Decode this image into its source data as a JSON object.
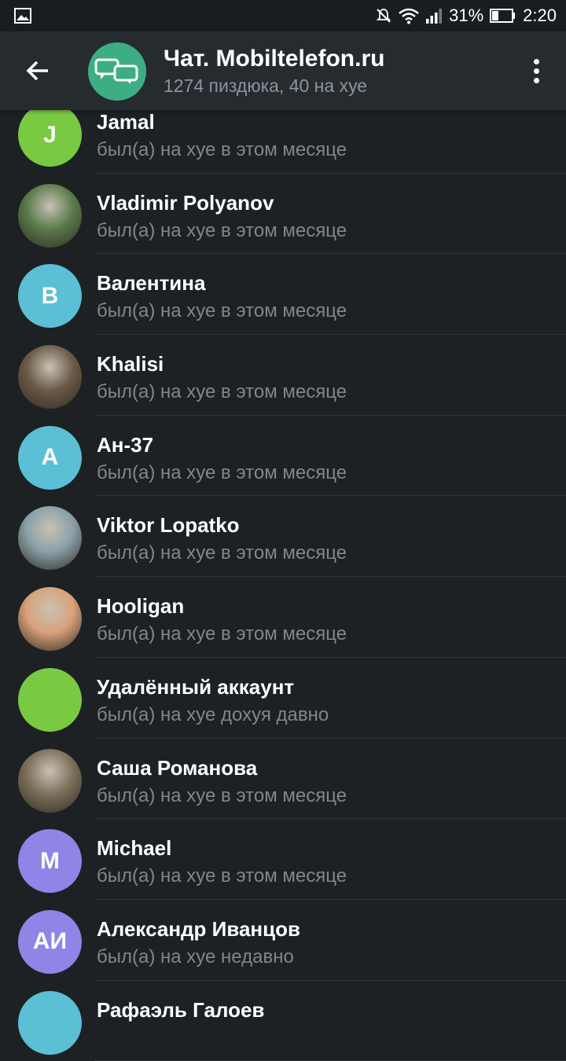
{
  "status_bar": {
    "battery_percent": "31%",
    "time": "2:20"
  },
  "header": {
    "title": "Чат. Mobiltelefon.ru",
    "subtitle": "1274 пиздюка, 40 на хуе",
    "avatar_color": "#3dae84"
  },
  "members": [
    {
      "name": "Jamal",
      "status": "был(а) на хуе в этом месяце",
      "initials": "J",
      "color": "#7ac943",
      "photo": false
    },
    {
      "name": "Vladimir Polyanov",
      "status": "был(а) на хуе в этом месяце",
      "initials": "",
      "color": "#5a7a4a",
      "photo": true
    },
    {
      "name": "Валентина",
      "status": "был(а) на хуе в этом месяце",
      "initials": "В",
      "color": "#5bbfd6",
      "photo": false
    },
    {
      "name": "Khalisi",
      "status": "был(а) на хуе в этом месяце",
      "initials": "",
      "color": "#6b5a48",
      "photo": true
    },
    {
      "name": "Ан-37",
      "status": "был(а) на хуе в этом месяце",
      "initials": "А",
      "color": "#5bbfd6",
      "photo": false
    },
    {
      "name": "Viktor Lopatko",
      "status": "был(а) на хуе в этом месяце",
      "initials": "",
      "color": "#8aa0a8",
      "photo": true
    },
    {
      "name": "Hooligan",
      "status": "был(а) на хуе в этом месяце",
      "initials": "",
      "color": "#d9a27a",
      "photo": true
    },
    {
      "name": "Удалённый аккаунт",
      "status": "был(а) на хуе дохуя давно",
      "initials": "",
      "color": "#7ac943",
      "photo": false
    },
    {
      "name": "Саша Романова",
      "status": "был(а) на хуе в этом месяце",
      "initials": "",
      "color": "#7d705a",
      "photo": true
    },
    {
      "name": "Michael",
      "status": "был(а) на хуе в этом месяце",
      "initials": "M",
      "color": "#8e85e6",
      "photo": false
    },
    {
      "name": "Александр Иванцов",
      "status": "был(а) на хуе недавно",
      "initials": "АИ",
      "color": "#8e85e6",
      "photo": false
    },
    {
      "name": "Рафаэль Галоев",
      "status": "",
      "initials": "",
      "color": "#5bbfd6",
      "photo": false
    }
  ]
}
